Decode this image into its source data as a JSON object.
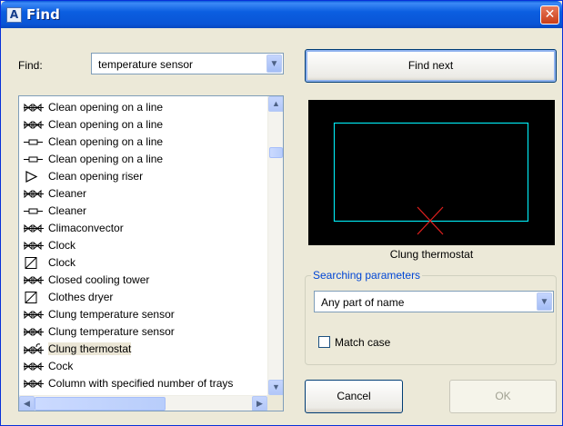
{
  "window": {
    "title": "Find",
    "app_icon_glyph": "A",
    "close_glyph": "✕"
  },
  "find": {
    "label": "Find:",
    "value": "temperature sensor"
  },
  "buttons": {
    "find_next": "Find next",
    "cancel": "Cancel",
    "ok": "OK"
  },
  "preview": {
    "caption": "Clung thermostat",
    "background": "#000000",
    "frame_color": "#00e5ee",
    "marker_color": "#e0201e"
  },
  "list": {
    "selected_index": 14,
    "items": [
      {
        "label": "Clean opening on a line",
        "icon": "valve-icon"
      },
      {
        "label": "Clean opening on a line",
        "icon": "valve-icon"
      },
      {
        "label": "Clean opening on a line",
        "icon": "line-plug-icon"
      },
      {
        "label": "Clean opening on a line",
        "icon": "line-plug-icon"
      },
      {
        "label": "Clean opening riser",
        "icon": "triangle-icon"
      },
      {
        "label": "Cleaner",
        "icon": "valve-icon"
      },
      {
        "label": "Cleaner",
        "icon": "line-plug-icon"
      },
      {
        "label": "Climaconvector",
        "icon": "valve-icon"
      },
      {
        "label": "Clock",
        "icon": "valve-icon"
      },
      {
        "label": "Clock",
        "icon": "box-slash-icon"
      },
      {
        "label": "Closed cooling tower",
        "icon": "valve-icon"
      },
      {
        "label": "Clothes dryer",
        "icon": "box-slash-icon"
      },
      {
        "label": "Clung temperature sensor",
        "icon": "valve-icon"
      },
      {
        "label": "Clung temperature sensor",
        "icon": "valve-icon"
      },
      {
        "label": "Clung thermostat",
        "icon": "thermostat-valve-icon"
      },
      {
        "label": "Cock",
        "icon": "valve-icon"
      },
      {
        "label": "Column with specified number of trays",
        "icon": "valve-icon"
      }
    ]
  },
  "search_params": {
    "title": "Searching parameters",
    "mode": "Any part of name",
    "match_case_label": "Match case",
    "match_case_checked": false
  },
  "scroll_glyphs": {
    "up": "▲",
    "down": "▼",
    "left": "◀",
    "right": "▶",
    "dropdown": "▼"
  }
}
